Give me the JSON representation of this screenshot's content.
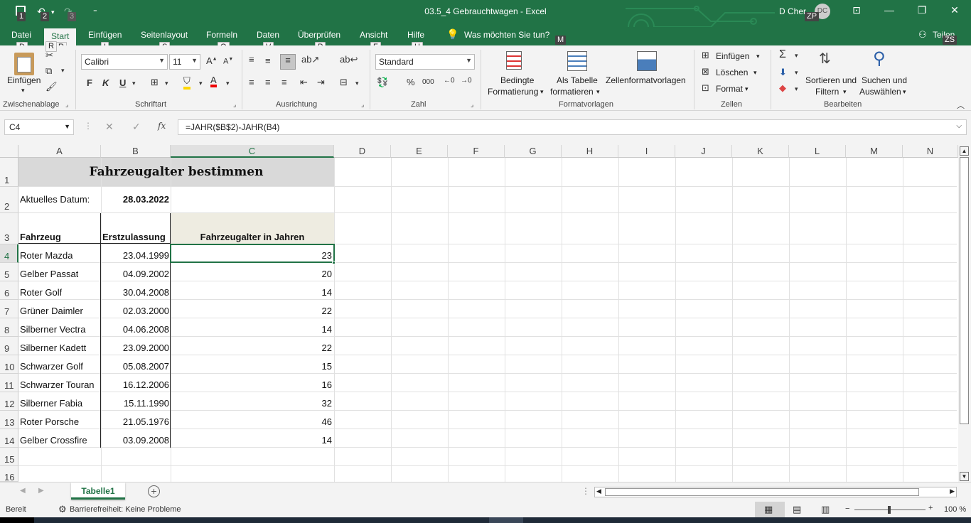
{
  "titlebar": {
    "title": "03.5_4 Gebrauchtwagen - Excel",
    "user": "D Cher",
    "avatar_initials": "DC",
    "qa_keys": [
      "1",
      "2",
      "3"
    ],
    "user_key": "ZP"
  },
  "tabs": [
    {
      "label": "Datei",
      "key": "D"
    },
    {
      "label": "Start",
      "key": "R"
    },
    {
      "label": "Einfügen",
      "key": "I"
    },
    {
      "label": "Seitenlayout",
      "key": "S"
    },
    {
      "label": "Formeln",
      "key": "O"
    },
    {
      "label": "Daten",
      "key": "V"
    },
    {
      "label": "Überprüfen",
      "key": "P"
    },
    {
      "label": "Ansicht",
      "key": "F"
    },
    {
      "label": "Hilfe",
      "key": "H"
    }
  ],
  "tellme": {
    "label": "Was möchten Sie tun?",
    "key": "M"
  },
  "share": {
    "label": "Teilen",
    "key": "ZS"
  },
  "ribbon": {
    "clipboard": {
      "paste": "Einfügen",
      "group": "Zwischenablage"
    },
    "font": {
      "name": "Calibri",
      "size": "11",
      "bold": "F",
      "italic": "K",
      "underline": "U",
      "group": "Schriftart"
    },
    "alignment": {
      "group": "Ausrichtung"
    },
    "number": {
      "format": "Standard",
      "group": "Zahl"
    },
    "styles": {
      "cond_line1": "Bedingte",
      "cond_line2": "Formatierung",
      "table_line1": "Als Tabelle",
      "table_line2": "formatieren",
      "cell_styles": "Zellenformatvorlagen",
      "group": "Formatvorlagen"
    },
    "cells": {
      "insert": "Einfügen",
      "delete": "Löschen",
      "format": "Format",
      "group": "Zellen"
    },
    "editing": {
      "sort_line1": "Sortieren und",
      "sort_line2": "Filtern",
      "find_line1": "Suchen und",
      "find_line2": "Auswählen",
      "group": "Bearbeiten"
    }
  },
  "formula_bar": {
    "name_box": "C4",
    "formula": "=JAHR($B$2)-JAHR(B4)"
  },
  "columns": [
    "A",
    "B",
    "C",
    "D",
    "E",
    "F",
    "G",
    "H",
    "I",
    "J",
    "K",
    "L",
    "M",
    "N"
  ],
  "rows": [
    "1",
    "2",
    "3",
    "4",
    "5",
    "6",
    "7",
    "8",
    "9",
    "10",
    "11",
    "12",
    "13",
    "14",
    "15",
    "16"
  ],
  "sheet": {
    "title": "Fahrzeugalter bestimmen",
    "date_label": "Aktuelles Datum:",
    "date_value": "28.03.2022",
    "headers": [
      "Fahrzeug",
      "Erstzulassung",
      "Fahrzeugalter in Jahren"
    ],
    "data": [
      [
        "Roter Mazda",
        "23.04.1999",
        "23"
      ],
      [
        "Gelber Passat",
        "04.09.2002",
        "20"
      ],
      [
        "Roter Golf",
        "30.04.2008",
        "14"
      ],
      [
        "Grüner Daimler",
        "02.03.2000",
        "22"
      ],
      [
        "Silberner Vectra",
        "04.06.2008",
        "14"
      ],
      [
        "Silberner Kadett",
        "23.09.2000",
        "22"
      ],
      [
        "Schwarzer Golf",
        "05.08.2007",
        "15"
      ],
      [
        "Schwarzer Touran",
        "16.12.2006",
        "16"
      ],
      [
        "Silberner Fabia",
        "15.11.1990",
        "32"
      ],
      [
        "Roter Porsche",
        "21.05.1976",
        "46"
      ],
      [
        "Gelber Crossfire",
        "03.09.2008",
        "14"
      ]
    ]
  },
  "sheet_tabs": [
    {
      "label": "Tabelle1"
    }
  ],
  "status": {
    "ready": "Bereit",
    "accessibility": "Barrierefreiheit: Keine Probleme",
    "zoom": "100 %"
  },
  "colors": {
    "accent": "#217346",
    "header_fill": "#d9d9d9",
    "col_c_fill": "#eeece1"
  }
}
